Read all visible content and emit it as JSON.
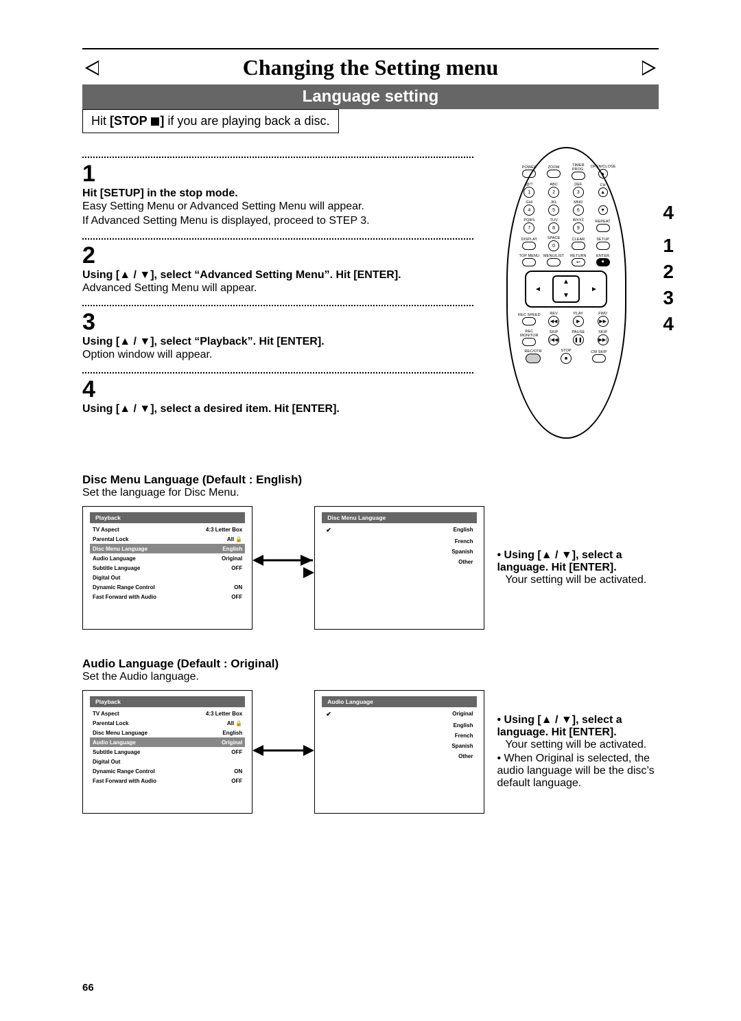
{
  "page_title": "Changing the Setting menu",
  "banner": "Language setting",
  "hit_stop_prefix": "Hit ",
  "hit_stop_label": "[STOP ",
  "hit_stop_suffix": "] ",
  "hit_stop_rest": "if you are playing back a disc.",
  "steps": {
    "1": {
      "num": "1",
      "head": "Hit [SETUP] in the stop mode.",
      "body1": "Easy Setting Menu or Advanced Setting Menu will appear.",
      "body2": "If Advanced Setting Menu is displayed, proceed to STEP 3."
    },
    "2": {
      "num": "2",
      "head": "Using [▲ / ▼], select “Advanced Setting Menu”. Hit [ENTER].",
      "body1": "Advanced Setting Menu will appear."
    },
    "3": {
      "num": "3",
      "head": "Using [▲ / ▼], select “Playback”. Hit [ENTER].",
      "body1": "Option window will appear."
    },
    "4": {
      "num": "4",
      "head": "Using [▲ / ▼], select a desired item. Hit [ENTER]."
    }
  },
  "remote_callouts": {
    "a": "4",
    "b": "1",
    "c": "2",
    "d": "3",
    "e": "4"
  },
  "remote_labels": {
    "power": "POWER",
    "zoom": "ZOOM",
    "timer_prog": "TIMER\nPROG.",
    "open_close": "OPEN/CLOSE",
    "at": "@!?",
    "abc": "ABC",
    "def": "DEF",
    "ch": "CH",
    "ghi": "GHI",
    "jkl": "JKL",
    "mno": "MNO",
    "pqrs": "PQRS",
    "tuv": "TUV",
    "wxyz": "WXYZ",
    "repeat": "REPEAT",
    "display": "DISPLAY",
    "space": "SPACE",
    "clear": "CLEAR",
    "setup": "SETUP",
    "topmenu": "TOP MENU",
    "menulist": "MENU/LIST",
    "return": "RETURN",
    "enter": "ENTER",
    "recspeed": "REC SPEED",
    "rev": "REV",
    "play": "PLAY",
    "fwd": "FWD",
    "recmon": "REC\nMONITOR",
    "skip": "SKIP",
    "pause": "PAUSE",
    "skip2": "SKIP",
    "recotr": "REC/OTR",
    "stop": "STOP",
    "cmskip": "CM SKIP"
  },
  "section1": {
    "head": "Disc Menu Language (Default : English)",
    "sub": "Set the language for Disc Menu.",
    "playback_header": "Playback",
    "rows": [
      {
        "l": "TV Aspect",
        "r": "4:3 Letter Box"
      },
      {
        "l": "Parental Lock",
        "r": "All 🔒"
      },
      {
        "l": "Disc Menu Language",
        "r": "English",
        "hl": true
      },
      {
        "l": "Audio Language",
        "r": "Original"
      },
      {
        "l": "Subtitle Language",
        "r": "OFF"
      },
      {
        "l": "Digital Out",
        "r": ""
      },
      {
        "l": "Dynamic Range Control",
        "r": "ON"
      },
      {
        "l": "Fast Forward with Audio",
        "r": "OFF"
      }
    ],
    "list_header": "Disc Menu Language",
    "list": [
      "English",
      "French",
      "Spanish",
      "Other"
    ],
    "checked": 0,
    "note_head": "• Using [▲ / ▼], select a language. Hit [ENTER].",
    "note_body": "Your setting will be activated."
  },
  "section2": {
    "head": "Audio Language (Default : Original)",
    "sub": "Set the Audio language.",
    "playback_header": "Playback",
    "rows": [
      {
        "l": "TV Aspect",
        "r": "4:3 Letter Box"
      },
      {
        "l": "Parental Lock",
        "r": "All 🔒"
      },
      {
        "l": "Disc Menu Language",
        "r": "English"
      },
      {
        "l": "Audio Language",
        "r": "Original",
        "hl": true
      },
      {
        "l": "Subtitle Language",
        "r": "OFF"
      },
      {
        "l": "Digital Out",
        "r": ""
      },
      {
        "l": "Dynamic Range Control",
        "r": "ON"
      },
      {
        "l": "Fast Forward with Audio",
        "r": "OFF"
      }
    ],
    "list_header": "Audio Language",
    "list": [
      "Original",
      "English",
      "French",
      "Spanish",
      "Other"
    ],
    "checked": 0,
    "note_head": "• Using [▲ / ▼], select a language. Hit [ENTER].",
    "note_body1": "Your setting will be activated.",
    "note_body2": "• When Original is selected, the audio language will be the disc’s default language."
  },
  "page_number": "66"
}
